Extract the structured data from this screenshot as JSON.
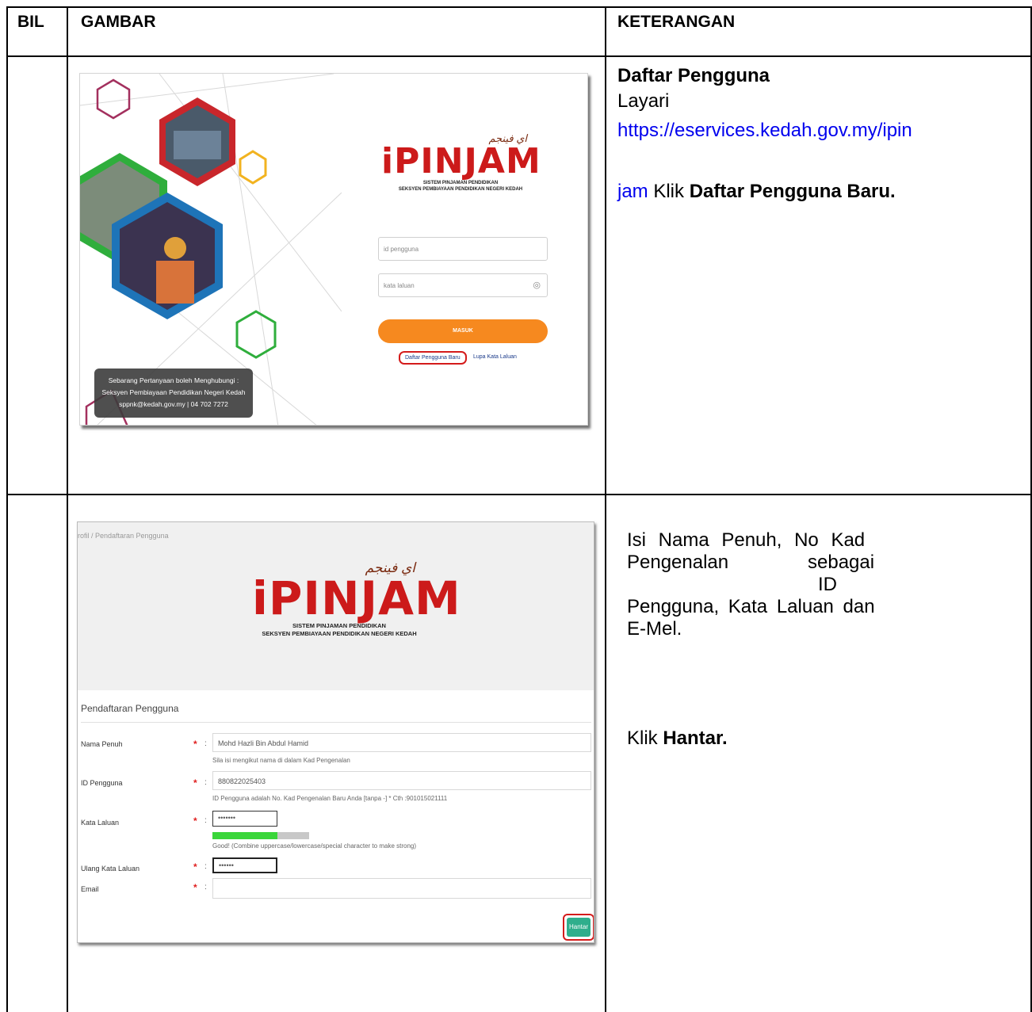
{
  "table": {
    "headers": {
      "bil": "BIL",
      "gambar": "GAMBAR",
      "keterangan": "KETERANGAN"
    }
  },
  "row1": {
    "title": "Daftar Pengguna",
    "layari": "Layari",
    "url_part1": "https://eservices.kedah.gov.my/ipin",
    "url_part2": "jam",
    "klik": "Klik",
    "action": "Daftar Pengguna Baru."
  },
  "row2": {
    "line1": "Isi Nama Penuh, No Kad",
    "line2a": "Pengenalan",
    "line2b": "sebagai",
    "line3": "ID",
    "line4": "Pengguna, Kata Laluan dan",
    "line5": "E-Mel.",
    "klik": "Klik",
    "action": "Hantar."
  },
  "login_screen": {
    "logo_text": "iPINJAM",
    "logo_arabic": "اي فينجم",
    "subtitle1": "SISTEM PINJAMAN PENDIDIKAN",
    "subtitle2": "SEKSYEN PEMBIAYAAN PENDIDIKAN NEGERI KEDAH",
    "username_placeholder": "id pengguna",
    "password_placeholder": "kata laluan",
    "eye_icon": "eye-off-icon",
    "login_button": "MASUK",
    "register_link": "Daftar Pengguna Baru",
    "forgot_link": "Lupa Kata Laluan",
    "contact_line1": "Sebarang Pertanyaan boleh Menghubungi :",
    "contact_line2": "Seksyen Pembiayaan Pendidikan Negeri Kedah",
    "contact_line3": "sppnk@kedah.gov.my | 04 702 7272",
    "accent_color": "#f6891f",
    "brand_color": "#cc1a1a"
  },
  "register_screen": {
    "breadcrumb": "rofil / Pendaftaran Pengguna",
    "logo_text": "iPINJAM",
    "logo_arabic": "اي فينجم",
    "subtitle1": "SISTEM PINJAMAN PENDIDIKAN",
    "subtitle2": "SEKSYEN PEMBIAYAAN PENDIDIKAN NEGERI KEDAH",
    "form_title": "Pendaftaran Pengguna",
    "required_mark": "*",
    "colon": ":",
    "fields": {
      "nama": {
        "label": "Nama Penuh",
        "value": "Mohd Hazli Bin Abdul Hamid",
        "hint": "Sila isi mengikut nama di dalam Kad Pengenalan"
      },
      "id": {
        "label": "ID Pengguna",
        "value": "880822025403",
        "hint": "ID Pengguna adalah No. Kad Pengenalan Baru Anda [tanpa -] * Cth :901015021111"
      },
      "password": {
        "label": "Kata Laluan",
        "value": "•••••••",
        "hint": "Good! (Combine uppercase/lowercase/special character to make strong)",
        "strength": 0.67
      },
      "confirm": {
        "label": "Ulang Kata Laluan",
        "value": "••••••"
      },
      "email": {
        "label": "Email",
        "value": ""
      }
    },
    "submit_button": "Hantar",
    "submit_color": "#2fae8c",
    "strength_color": "#3ad63a"
  }
}
